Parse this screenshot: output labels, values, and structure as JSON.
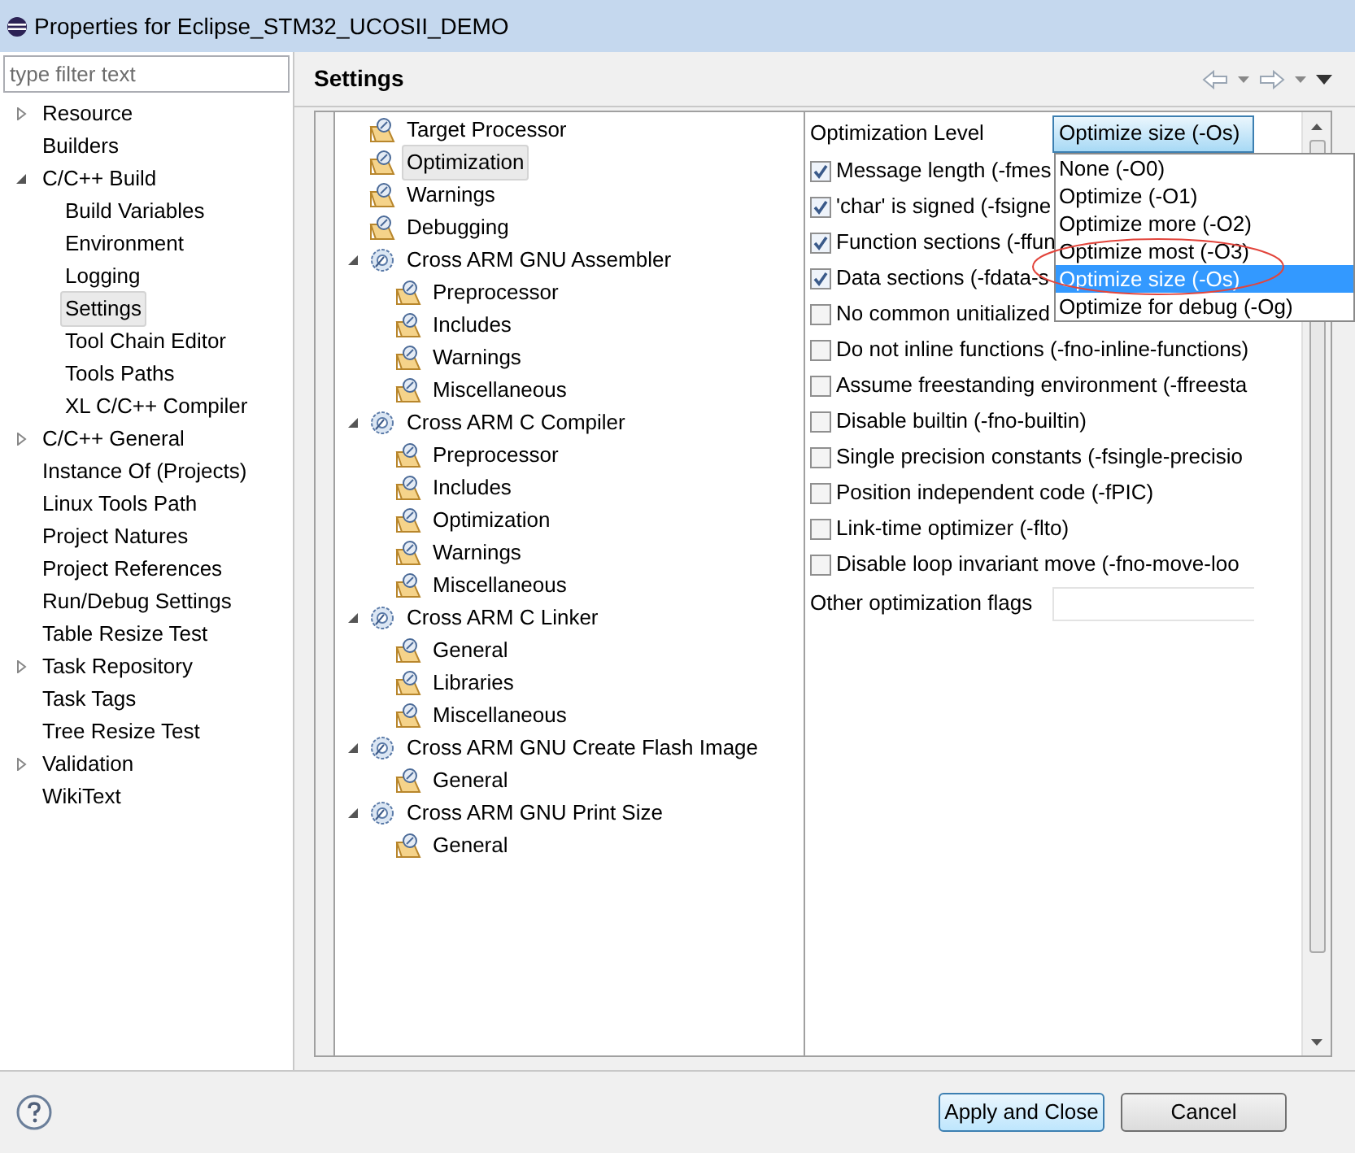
{
  "window": {
    "title": "Properties for Eclipse_STM32_UCOSII_DEMO"
  },
  "filter": {
    "placeholder": "type filter text"
  },
  "nav": [
    {
      "label": "Resource",
      "expanded": false,
      "selected": false
    },
    {
      "label": "Builders",
      "selected": false
    },
    {
      "label": "C/C++ Build",
      "expanded": true,
      "selected": false,
      "children": [
        {
          "label": "Build Variables",
          "selected": false
        },
        {
          "label": "Environment",
          "selected": false
        },
        {
          "label": "Logging",
          "selected": false
        },
        {
          "label": "Settings",
          "selected": true
        },
        {
          "label": "Tool Chain Editor",
          "selected": false
        },
        {
          "label": "Tools Paths",
          "selected": false
        },
        {
          "label": "XL C/C++ Compiler",
          "selected": false
        }
      ]
    },
    {
      "label": "C/C++ General",
      "expanded": false,
      "selected": false
    },
    {
      "label": "Instance Of (Projects)",
      "selected": false
    },
    {
      "label": "Linux Tools Path",
      "selected": false
    },
    {
      "label": "Project Natures",
      "selected": false
    },
    {
      "label": "Project References",
      "selected": false
    },
    {
      "label": "Run/Debug Settings",
      "selected": false
    },
    {
      "label": "Table Resize Test",
      "selected": false
    },
    {
      "label": "Task Repository",
      "expanded": false,
      "selected": false
    },
    {
      "label": "Task Tags",
      "selected": false
    },
    {
      "label": "Tree Resize Test",
      "selected": false
    },
    {
      "label": "Validation",
      "expanded": false,
      "selected": false
    },
    {
      "label": "WikiText",
      "selected": false
    }
  ],
  "page_title": "Settings",
  "tool_tree": [
    {
      "label": "Target Processor",
      "selected": false
    },
    {
      "label": "Optimization",
      "selected": true
    },
    {
      "label": "Warnings",
      "selected": false
    },
    {
      "label": "Debugging",
      "selected": false
    },
    {
      "label": "Cross ARM GNU Assembler",
      "expanded": true,
      "selected": false,
      "children": [
        {
          "label": "Preprocessor",
          "selected": false
        },
        {
          "label": "Includes",
          "selected": false
        },
        {
          "label": "Warnings",
          "selected": false
        },
        {
          "label": "Miscellaneous",
          "selected": false
        }
      ]
    },
    {
      "label": "Cross ARM C Compiler",
      "expanded": true,
      "selected": false,
      "children": [
        {
          "label": "Preprocessor",
          "selected": false
        },
        {
          "label": "Includes",
          "selected": false
        },
        {
          "label": "Optimization",
          "selected": false
        },
        {
          "label": "Warnings",
          "selected": false
        },
        {
          "label": "Miscellaneous",
          "selected": false
        }
      ]
    },
    {
      "label": "Cross ARM C Linker",
      "expanded": true,
      "selected": false,
      "children": [
        {
          "label": "General",
          "selected": false
        },
        {
          "label": "Libraries",
          "selected": false
        },
        {
          "label": "Miscellaneous",
          "selected": false
        }
      ]
    },
    {
      "label": "Cross ARM GNU Create Flash Image",
      "expanded": true,
      "selected": false,
      "children": [
        {
          "label": "General",
          "selected": false
        }
      ]
    },
    {
      "label": "Cross ARM GNU Print Size",
      "expanded": true,
      "selected": false,
      "children": [
        {
          "label": "General",
          "selected": false
        }
      ]
    }
  ],
  "optimization_level": {
    "label": "Optimization Level",
    "value": "Optimize size (-Os)",
    "options": [
      {
        "label": "None (-O0)",
        "selected": false
      },
      {
        "label": "Optimize (-O1)",
        "selected": false
      },
      {
        "label": "Optimize more (-O2)",
        "selected": false
      },
      {
        "label": "Optimize most (-O3)",
        "selected": false
      },
      {
        "label": "Optimize size (-Os)",
        "selected": true
      },
      {
        "label": "Optimize for debug (-Og)",
        "selected": false
      }
    ]
  },
  "options": [
    {
      "label": "Message length (-fmes",
      "checked": true
    },
    {
      "label": "'char' is signed (-fsigne",
      "checked": true
    },
    {
      "label": "Function sections (-ffun",
      "checked": true
    },
    {
      "label": "Data sections (-fdata-s",
      "checked": true
    },
    {
      "label": "No common unitialized",
      "checked": false
    },
    {
      "label": "Do not inline functions (-fno-inline-functions)",
      "checked": false
    },
    {
      "label": "Assume freestanding environment (-ffreesta",
      "checked": false
    },
    {
      "label": "Disable builtin (-fno-builtin)",
      "checked": false
    },
    {
      "label": "Single precision constants (-fsingle-precisio",
      "checked": false
    },
    {
      "label": "Position independent code (-fPIC)",
      "checked": false
    },
    {
      "label": "Link-time optimizer (-flto)",
      "checked": false
    },
    {
      "label": "Disable loop invariant move (-fno-move-loo",
      "checked": false
    }
  ],
  "other_flags": {
    "label": "Other optimization flags"
  },
  "buttons": [
    {
      "label": "Apply and Close",
      "kind": "primary"
    },
    {
      "label": "Cancel",
      "kind": "normal"
    }
  ]
}
